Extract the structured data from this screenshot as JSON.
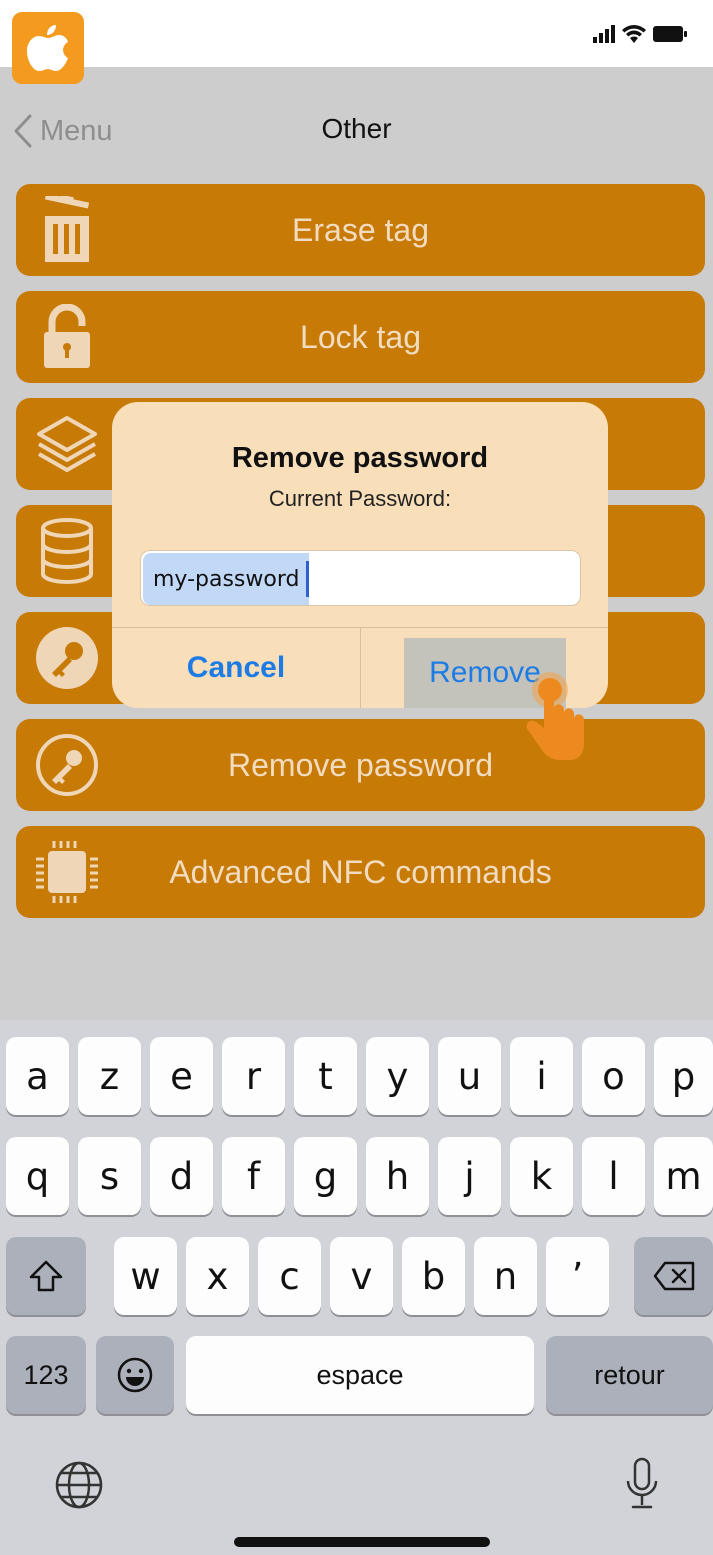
{
  "nav": {
    "back_label": "Menu",
    "title": "Other"
  },
  "menu": {
    "items": [
      {
        "label": "Erase tag",
        "icon": "trash-icon"
      },
      {
        "label": "Lock tag",
        "icon": "padlock-icon"
      },
      {
        "label": "",
        "icon": "layers-icon"
      },
      {
        "label": "",
        "icon": "database-icon"
      },
      {
        "label": "",
        "icon": "key-circle-icon"
      },
      {
        "label": "Remove password",
        "icon": "key-circle-icon"
      },
      {
        "label": "Advanced NFC commands",
        "icon": "chip-icon"
      }
    ]
  },
  "dialog": {
    "title": "Remove password",
    "message": "Current Password:",
    "password_value": "my-password",
    "cancel_label": "Cancel",
    "remove_label": "Remove"
  },
  "keyboard": {
    "row1": [
      "a",
      "z",
      "e",
      "r",
      "t",
      "y",
      "u",
      "i",
      "o",
      "p"
    ],
    "row2": [
      "q",
      "s",
      "d",
      "f",
      "g",
      "h",
      "j",
      "k",
      "l",
      "m"
    ],
    "row3": [
      "w",
      "x",
      "c",
      "v",
      "b",
      "n",
      "’"
    ],
    "numbers_label": "123",
    "space_label": "espace",
    "return_label": "retour"
  },
  "colors": {
    "accent": "#c77a06",
    "link_blue": "#1d7be6",
    "logo_orange": "#f49a1e"
  }
}
